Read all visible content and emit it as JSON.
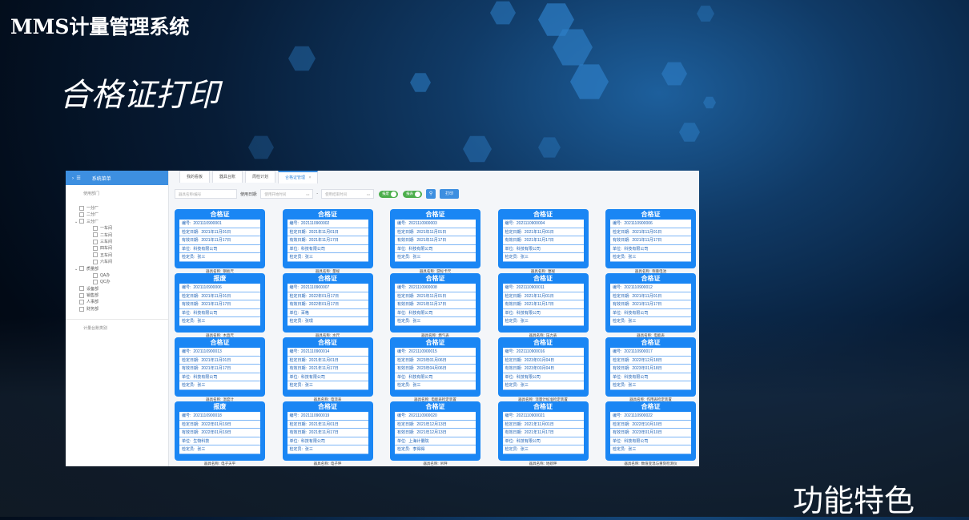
{
  "header": {
    "system_title": "MMS计量管理系统",
    "page_heading": "合格证打印",
    "feature_label": "功能特色"
  },
  "app": {
    "sidebar": {
      "menu_icon": "menu-icon",
      "title": "系统菜单",
      "dept_section": "使用部门",
      "tree": [
        {
          "label": "一分厂",
          "level": 0
        },
        {
          "label": "二分厂",
          "level": 0
        },
        {
          "label": "三分厂",
          "level": 0,
          "expanded": true
        },
        {
          "label": "一车间",
          "level": 1
        },
        {
          "label": "二车间",
          "level": 1
        },
        {
          "label": "三车间",
          "level": 1
        },
        {
          "label": "四车间",
          "level": 1
        },
        {
          "label": "五车间",
          "level": 1
        },
        {
          "label": "六车间",
          "level": 1
        },
        {
          "label": "质量部",
          "level": 0,
          "expanded": true
        },
        {
          "label": "QA办",
          "level": 1
        },
        {
          "label": "QC办",
          "level": 1
        },
        {
          "label": "设备部",
          "level": 0
        },
        {
          "label": "销售部",
          "level": 0
        },
        {
          "label": "人事部",
          "level": 0
        },
        {
          "label": "财务部",
          "level": 0
        }
      ],
      "category_section": "计量台账类别"
    },
    "tabs": [
      {
        "label": "我的看板"
      },
      {
        "label": "器具台账"
      },
      {
        "label": "周检计划"
      },
      {
        "label": "合格证管理",
        "active": true,
        "close": "×"
      }
    ],
    "filters": {
      "search_placeholder": "器具名称/编号",
      "date_label": "使用日期:",
      "start_placeholder": "使用开始时间",
      "sep": "-",
      "end_placeholder": "使用结束时间",
      "toggle1": "报废",
      "toggle2": "报表",
      "print_label": "打印"
    },
    "labels": {
      "no": "编号:",
      "check_date": "检定日期:",
      "valid_date": "有效日期:",
      "unit": "单位:",
      "inspector": "检定员:",
      "name": "器具名称:"
    },
    "cards": [
      {
        "title": "合格证",
        "no": "2021110900001",
        "check": "2021年11月01日",
        "valid": "2021年11月17日",
        "unit": "科技有限公司",
        "inspector": "张三",
        "name": "钢板尺"
      },
      {
        "title": "合格证",
        "no": "2021110900002",
        "check": "2021年11月01日",
        "valid": "2021年11月17日",
        "unit": "科技有限公司",
        "inspector": "张三",
        "name": "量规"
      },
      {
        "title": "合格证",
        "no": "2021110900003",
        "check": "2021年11月01日",
        "valid": "2021年11月17日",
        "unit": "科技有限公司",
        "inspector": "张三",
        "name": "游标卡尺"
      },
      {
        "title": "合格证",
        "no": "2021110900004",
        "check": "2021年11月01日",
        "valid": "2021年11月17日",
        "unit": "科技有限公司",
        "inspector": "张三",
        "name": "塞规"
      },
      {
        "title": "合格证",
        "no": "2021110900006",
        "check": "2021年11月01日",
        "valid": "2021年11月17日",
        "unit": "科技有限公司",
        "inspector": "张三",
        "name": "称重电池"
      },
      {
        "title": "报废",
        "no": "2021110900006",
        "check": "2021年11月01日",
        "valid": "2021年11月17日",
        "unit": "科技有限公司",
        "inspector": "张三",
        "name": "木直尺"
      },
      {
        "title": "合格证",
        "no": "2021110900007",
        "check": "2022年01月17日",
        "valid": "2022年01月17日",
        "unit": "百格",
        "inspector": "张璟",
        "name": "水尺"
      },
      {
        "title": "合格证",
        "no": "2021110900008",
        "check": "2021年11月01日",
        "valid": "2021年11月17日",
        "unit": "科技有限公司",
        "inspector": "张三",
        "name": "燃气表"
      },
      {
        "title": "合格证",
        "no": "2021110900011",
        "check": "2021年11月01日",
        "valid": "2021年11月17日",
        "unit": "科技有限公司",
        "inspector": "张三",
        "name": "压力表"
      },
      {
        "title": "合格证",
        "no": "2021110900012",
        "check": "2021年11月01日",
        "valid": "2021年11月17日",
        "unit": "科技有限公司",
        "inspector": "张三",
        "name": "电能表"
      },
      {
        "title": "合格证",
        "no": "2021110900013",
        "check": "2021年11月01日",
        "valid": "2021年11月17日",
        "unit": "科技有限公司",
        "inspector": "张三",
        "name": "温度计"
      },
      {
        "title": "合格证",
        "no": "2021110900014",
        "check": "2021年11月01日",
        "valid": "2021年11月17日",
        "unit": "科技有限公司",
        "inspector": "张三",
        "name": "电流表"
      },
      {
        "title": "合格证",
        "no": "2021110900015",
        "check": "2023年01月06日",
        "valid": "2023年04月06日",
        "unit": "科技有限公司",
        "inspector": "张三",
        "name": "电能表检定装置"
      },
      {
        "title": "合格证",
        "no": "2021110900016",
        "check": "2023年01月04日",
        "valid": "2023年03月04日",
        "unit": "科技有限公司",
        "inspector": "张三",
        "name": "流量计标准检定装置"
      },
      {
        "title": "合格证",
        "no": "2021110900017",
        "check": "2022年12月18日",
        "valid": "2023年01月18日",
        "unit": "科技有限公司",
        "inspector": "张三",
        "name": "作用表检定装置"
      },
      {
        "title": "报废",
        "no": "2021110900018",
        "check": "2022年01月19日",
        "valid": "2022年01月19日",
        "unit": "生物科技",
        "inspector": "张三",
        "name": "电子天平"
      },
      {
        "title": "合格证",
        "no": "2021110900019",
        "check": "2021年11月01日",
        "valid": "2021年11月17日",
        "unit": "科技有限公司",
        "inspector": "张三",
        "name": "电子秤"
      },
      {
        "title": "合格证",
        "no": "2021110900020",
        "check": "2021年12月13日",
        "valid": "2021年12月13日",
        "unit": "上海计量院",
        "inspector": "李得得",
        "name": "吊秤"
      },
      {
        "title": "合格证",
        "no": "2021110900021",
        "check": "2021年11月01日",
        "valid": "2021年11月17日",
        "unit": "科技有限公司",
        "inspector": "张三",
        "name": "地磅秤"
      },
      {
        "title": "合格证",
        "no": "2021110900022",
        "check": "2022年10月10日",
        "valid": "2023年01月10日",
        "unit": "科技有限公司",
        "inspector": "张三",
        "name": "数值变温与重刻检测仪"
      }
    ]
  }
}
